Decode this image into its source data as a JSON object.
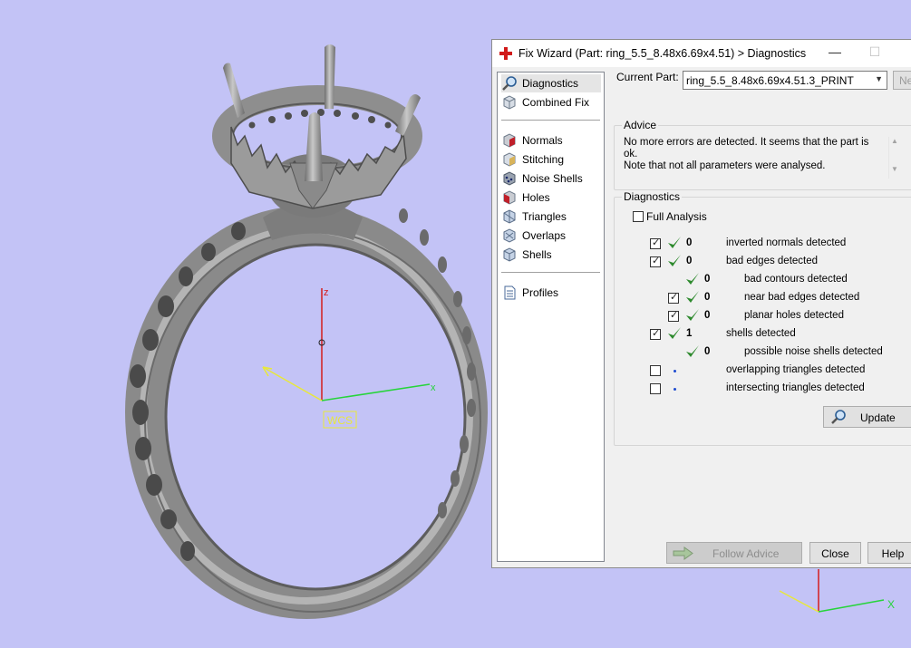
{
  "viewport": {
    "background": "#c3c3f6",
    "axis_labels": {
      "z": "z",
      "x": "x",
      "wcs": "WCS",
      "mini_x": "X"
    }
  },
  "dialog": {
    "title": "Fix Wizard (Part: ring_5.5_8.48x6.69x4.51) > Diagnostics",
    "window_controls": {
      "minimize": "—",
      "maximize": "☐"
    },
    "nav": {
      "top_items": [
        {
          "label": "Diagnostics",
          "icon": "magnifier-icon",
          "selected": true
        },
        {
          "label": "Combined Fix",
          "icon": "cube-icon",
          "selected": false
        }
      ],
      "fix_items": [
        {
          "label": "Normals",
          "icon": "normals-cube-icon"
        },
        {
          "label": "Stitching",
          "icon": "stitching-cube-icon"
        },
        {
          "label": "Noise Shells",
          "icon": "noise-shells-icon"
        },
        {
          "label": "Holes",
          "icon": "holes-cube-icon"
        },
        {
          "label": "Triangles",
          "icon": "triangles-cube-icon"
        },
        {
          "label": "Overlaps",
          "icon": "overlaps-cube-icon"
        },
        {
          "label": "Shells",
          "icon": "shells-cube-icon"
        }
      ],
      "bottom_items": [
        {
          "label": "Profiles",
          "icon": "document-icon"
        }
      ]
    },
    "current_part": {
      "label": "Current Part:",
      "value": "ring_5.5_8.48x6.69x4.51.3_PRINT",
      "next_button": "Ne"
    },
    "advice": {
      "title": "Advice",
      "line1": "No more errors are detected. It seems that the part is ok.",
      "line2": "Note that not all parameters were analysed."
    },
    "diagnostics": {
      "title": "Diagnostics",
      "full_analysis": "Full Analysis",
      "rows": [
        {
          "label": "inverted normals detected",
          "count": "0",
          "checked": true,
          "status": "ok"
        },
        {
          "label": "bad edges detected",
          "count": "0",
          "checked": true,
          "status": "ok"
        },
        {
          "label": "bad contours detected",
          "count": "0",
          "checked": null,
          "status": "ok"
        },
        {
          "label": "near bad edges detected",
          "count": "0",
          "checked": true,
          "status": "ok"
        },
        {
          "label": "planar holes detected",
          "count": "0",
          "checked": true,
          "status": "ok"
        },
        {
          "label": "shells detected",
          "count": "1",
          "checked": true,
          "status": "ok"
        },
        {
          "label": "possible noise shells detected",
          "count": "0",
          "checked": null,
          "status": "ok"
        },
        {
          "label": "overlapping triangles detected",
          "count": "",
          "checked": false,
          "status": "not-run"
        },
        {
          "label": "intersecting triangles detected",
          "count": "",
          "checked": false,
          "status": "not-run"
        }
      ],
      "update_button": "Update"
    },
    "buttons": {
      "follow_advice": "Follow Advice",
      "close": "Close",
      "help": "Help"
    }
  },
  "colors": {
    "check_green": "#2e8a2e",
    "accent_red": "#d11a1a"
  }
}
